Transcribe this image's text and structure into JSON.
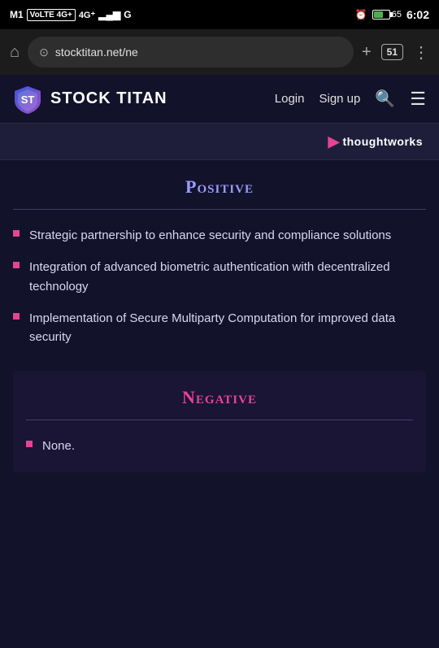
{
  "statusBar": {
    "carrier": "M1",
    "networkType": "VoLTE 4G+",
    "signalBars": "▂▄▆",
    "extraIcon": "G",
    "alarmIcon": "⏰",
    "batteryPercent": "65",
    "time": "6:02"
  },
  "browser": {
    "url": "stocktitan.net/ne",
    "tabsCount": "51",
    "homeLabel": "⌂",
    "newTabLabel": "+",
    "menuLabel": "⋮"
  },
  "nav": {
    "logoText": "STOCK TITAN",
    "loginLabel": "Login",
    "signupLabel": "Sign up"
  },
  "brandBanner": {
    "arrowSymbol": "▶",
    "brandName": "thoughtworks"
  },
  "positive": {
    "title": "Positive",
    "bullets": [
      "Strategic partnership to enhance security and compliance solutions",
      "Integration of advanced biometric authentication with decentralized technology",
      "Implementation of Secure Multiparty Computation for improved data security"
    ]
  },
  "negative": {
    "title": "Negative",
    "bullets": [
      "None."
    ]
  }
}
